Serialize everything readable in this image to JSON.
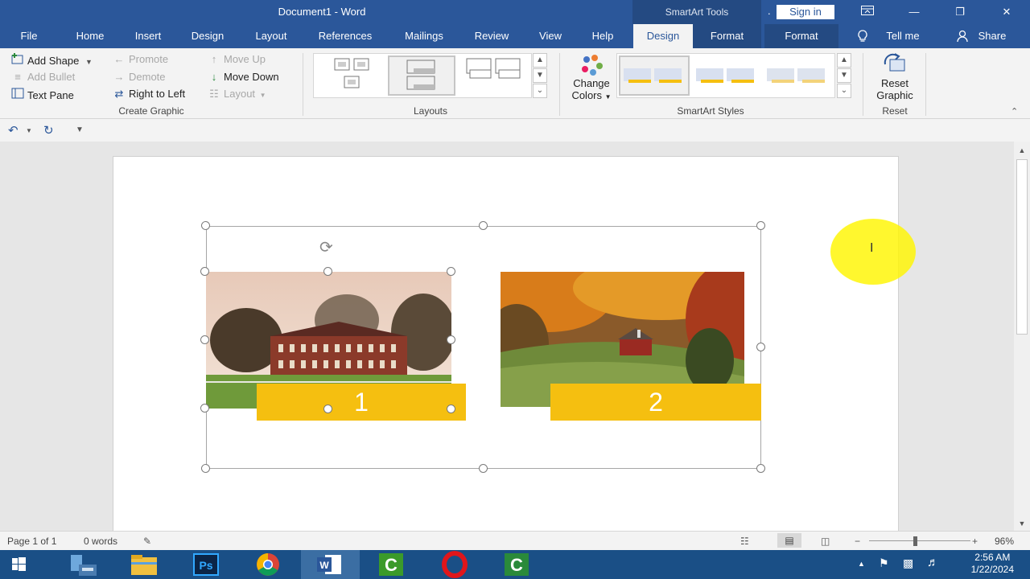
{
  "window": {
    "title": "Document1  -  Word",
    "context_label": "SmartArt Tools",
    "signin_label": "Sign in"
  },
  "tabs": [
    {
      "label": "File"
    },
    {
      "label": "Home"
    },
    {
      "label": "Insert"
    },
    {
      "label": "Design"
    },
    {
      "label": "Layout"
    },
    {
      "label": "References"
    },
    {
      "label": "Mailings"
    },
    {
      "label": "Review"
    },
    {
      "label": "View"
    },
    {
      "label": "Help"
    },
    {
      "label": "Design"
    },
    {
      "label": "Format"
    },
    {
      "label": "Format"
    }
  ],
  "tell_me": "Tell me",
  "share": "Share",
  "ribbon": {
    "create_graphic": {
      "label": "Create Graphic",
      "add_shape": "Add Shape",
      "add_bullet": "Add Bullet",
      "text_pane": "Text Pane",
      "promote": "Promote",
      "demote": "Demote",
      "right_to_left": "Right to Left",
      "move_up": "Move Up",
      "move_down": "Move Down",
      "layout": "Layout"
    },
    "layouts": {
      "label": "Layouts"
    },
    "change_colors": {
      "line1": "Change",
      "line2": "Colors"
    },
    "smartart_styles": {
      "label": "SmartArt Styles"
    },
    "reset": {
      "label": "Reset",
      "line1": "Reset",
      "line2": "Graphic"
    }
  },
  "smartart": {
    "captions": [
      "1",
      "2"
    ]
  },
  "status": {
    "page": "Page 1 of 1",
    "words": "0 words",
    "zoom": "96%"
  },
  "taskbar": {
    "time": "2:56 AM",
    "date": "1/22/2024",
    "apps": [
      "Start",
      "File Explorer",
      "Photoshop",
      "Chrome",
      "Word",
      "Camtasia",
      "Opera",
      "Camtasia Recorder"
    ]
  },
  "colors": {
    "word_blue": "#2b579a",
    "caption_yellow": "#f5bf10"
  }
}
